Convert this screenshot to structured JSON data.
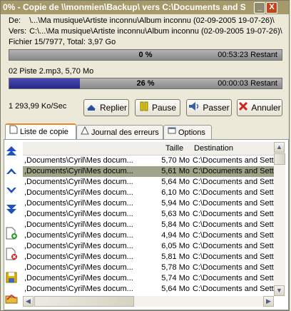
{
  "window": {
    "title": "0% - Copie de \\\\monmien\\Backup\\ vers C:\\Documents and Setti",
    "minimize_label": "_",
    "close_label": "X"
  },
  "info": {
    "from_label": "De:",
    "from_value": "\\...\\Ma musique\\Artiste inconnu\\Album inconnu (02-09-2005 19-07-26)\\",
    "to_label": "Vers:",
    "to_value": "C:\\...\\Ma musique\\Artiste inconnu\\Album inconnu (02-09-2005 19-07-26)\\",
    "file_count": "Fichier 15/7977, Total: 3,97 Go",
    "total_progress": {
      "percent_text": "0 %",
      "fraction": 0.0,
      "remaining": "00:53:23 Restant"
    },
    "current_file": "02 Piste 2.mp3, 5,70 Mo",
    "file_progress": {
      "percent_text": "26 %",
      "fraction": 0.26,
      "remaining": "00:00:03 Restant"
    },
    "speed": "1 293,99 Ko/Sec"
  },
  "buttons": {
    "replier": "Replier",
    "pause": "Pause",
    "passer": "Passer",
    "annuler": "Annuler"
  },
  "tabs": [
    {
      "label": "Liste de copie",
      "active": true
    },
    {
      "label": "Journal des erreurs",
      "active": false
    },
    {
      "label": "Options",
      "active": false
    }
  ],
  "table": {
    "columns": [
      "",
      "Taille",
      "Destination"
    ],
    "rows": [
      {
        "source": ",Documents\\Cyril\\Mes docum...",
        "size": "5,70 Mo",
        "dest": "C:\\Documents and Setti"
      },
      {
        "source": ",Documents\\Cyril\\Mes docum...",
        "size": "5,61 Mo",
        "dest": "C:\\Documents and Setti"
      },
      {
        "source": ",Documents\\Cyril\\Mes docum...",
        "size": "5,64 Mo",
        "dest": "C:\\Documents and Setti"
      },
      {
        "source": ",Documents\\Cyril\\Mes docum...",
        "size": "6,10 Mo",
        "dest": "C:\\Documents and Setti"
      },
      {
        "source": ",Documents\\Cyril\\Mes docum...",
        "size": "5,94 Mo",
        "dest": "C:\\Documents and Setti"
      },
      {
        "source": ",Documents\\Cyril\\Mes docum...",
        "size": "5,63 Mo",
        "dest": "C:\\Documents and Setti"
      },
      {
        "source": ",Documents\\Cyril\\Mes docum...",
        "size": "5,84 Mo",
        "dest": "C:\\Documents and Setti"
      },
      {
        "source": ",Documents\\Cyril\\Mes docum...",
        "size": "4,94 Mo",
        "dest": "C:\\Documents and Setti"
      },
      {
        "source": ",Documents\\Cyril\\Mes docum...",
        "size": "6,05 Mo",
        "dest": "C:\\Documents and Setti"
      },
      {
        "source": ",Documents\\Cyril\\Mes docum...",
        "size": "5,81 Mo",
        "dest": "C:\\Documents and Setti"
      },
      {
        "source": ",Documents\\Cyril\\Mes docum...",
        "size": "5,78 Mo",
        "dest": "C:\\Documents and Setti"
      },
      {
        "source": ",Documents\\Cyril\\Mes docum...",
        "size": "5,74 Mo",
        "dest": "C:\\Documents and Setti"
      },
      {
        "source": ",Documents\\Cyril\\Mes docum...",
        "size": "5,64 Mo",
        "dest": "C:\\Documents and Setti"
      },
      {
        "source": ",Documents\\Cyril\\Mes docum...",
        "size": "6,00 Mo",
        "dest": "C:\\Documents and Setti"
      },
      {
        "source": ",Documents\\Cyril\\Mes docum...",
        "size": "5,47 Mo",
        "dest": "C:\\Documents and Setti"
      }
    ],
    "selected_row": 1
  },
  "colors": {
    "titlebar": "#a69a6a",
    "progress_fill": "#262688",
    "selection": "#9fa38a",
    "active_tab_accent": "#e68b2c"
  },
  "icons": {
    "sidebar": [
      "move-top-icon",
      "move-up-icon",
      "move-down-icon",
      "move-bottom-icon",
      "add-file-icon",
      "remove-file-icon",
      "save-list-icon",
      "load-list-icon"
    ]
  }
}
